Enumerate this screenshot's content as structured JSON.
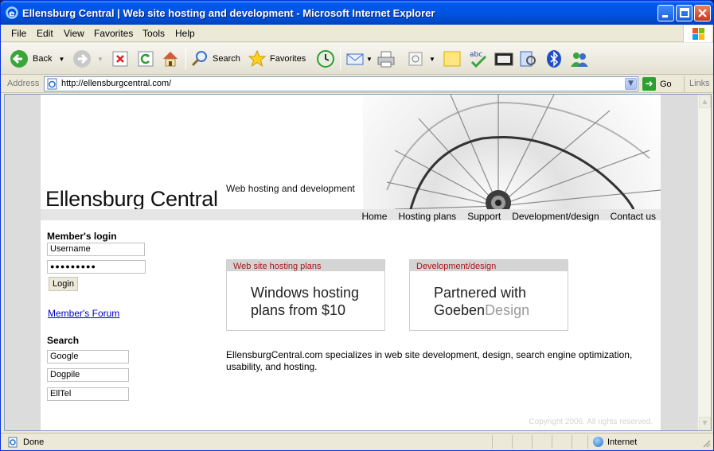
{
  "window": {
    "title": "Ellensburg Central | Web site hosting and development - Microsoft Internet Explorer"
  },
  "menu": {
    "items": [
      "File",
      "Edit",
      "View",
      "Favorites",
      "Tools",
      "Help"
    ]
  },
  "toolbar": {
    "back_label": "Back",
    "search_label": "Search",
    "favorites_label": "Favorites"
  },
  "address": {
    "label": "Address",
    "url": "http://ellensburgcentral.com/",
    "go_label": "Go",
    "links_label": "Links"
  },
  "site": {
    "title": "Ellensburg Central",
    "tagline": "Web hosting and development",
    "nav": [
      "Home",
      "Hosting plans",
      "Support",
      "Development/design",
      "Contact us"
    ]
  },
  "login": {
    "heading": "Member's login",
    "username_value": "Username",
    "password_value": "●●●●●●●●●",
    "button_label": "Login",
    "forum_link": "Member's Forum"
  },
  "search": {
    "heading": "Search",
    "engines": [
      "Google",
      "Dogpile",
      "EllTel"
    ]
  },
  "promos": {
    "hosting": {
      "header": "Web site hosting plans",
      "line1": "Windows hosting",
      "line2": "plans from $10"
    },
    "design": {
      "header": "Development/design",
      "line1": "Partnered with",
      "brand_a": "Goeben",
      "brand_b": "Design"
    }
  },
  "intro_text": "EllensburgCentral.com specializes in web site development, design, search engine optimization, usability, and hosting.",
  "copyright": "Copyright 2006. All rights reserved.",
  "status": {
    "text": "Done",
    "zone": "Internet"
  }
}
